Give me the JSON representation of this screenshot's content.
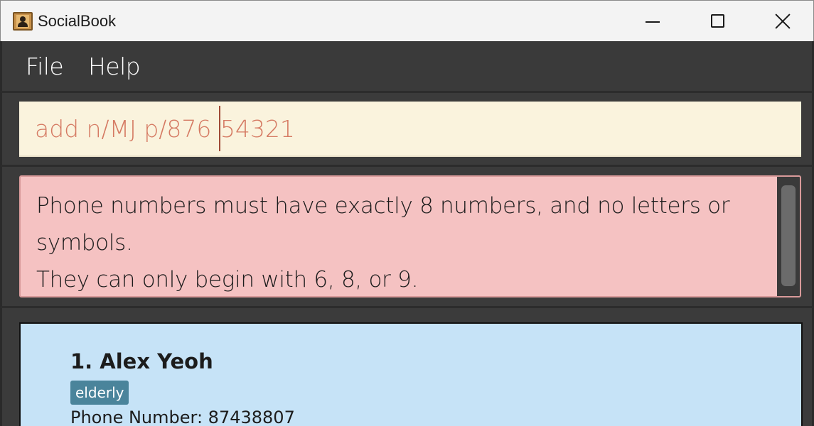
{
  "window": {
    "title": "SocialBook",
    "icon": "address-book-icon"
  },
  "menu": {
    "items": [
      {
        "label": "File"
      },
      {
        "label": "Help"
      }
    ]
  },
  "command_box": {
    "value_before_caret": "add n/MJ p/876 ",
    "value_after_caret": "54321"
  },
  "result_display": {
    "lines": [
      "Phone numbers must have exactly 8 numbers, and no letters or",
      "symbols.",
      "They can only begin with 6, 8, or 9."
    ]
  },
  "person_list": {
    "persons": [
      {
        "index_name": "1. Alex Yeoh",
        "tags": [
          "elderly"
        ],
        "phone_line": "Phone Number: 87438807"
      }
    ]
  },
  "colors": {
    "command_bg": "#faf3dd",
    "command_text": "#d57a63",
    "error_bg": "#f5c2c2",
    "card_bg": "#c6e3f7",
    "tag_bg": "#4a849b",
    "dark_bg": "#3b3b3b"
  }
}
